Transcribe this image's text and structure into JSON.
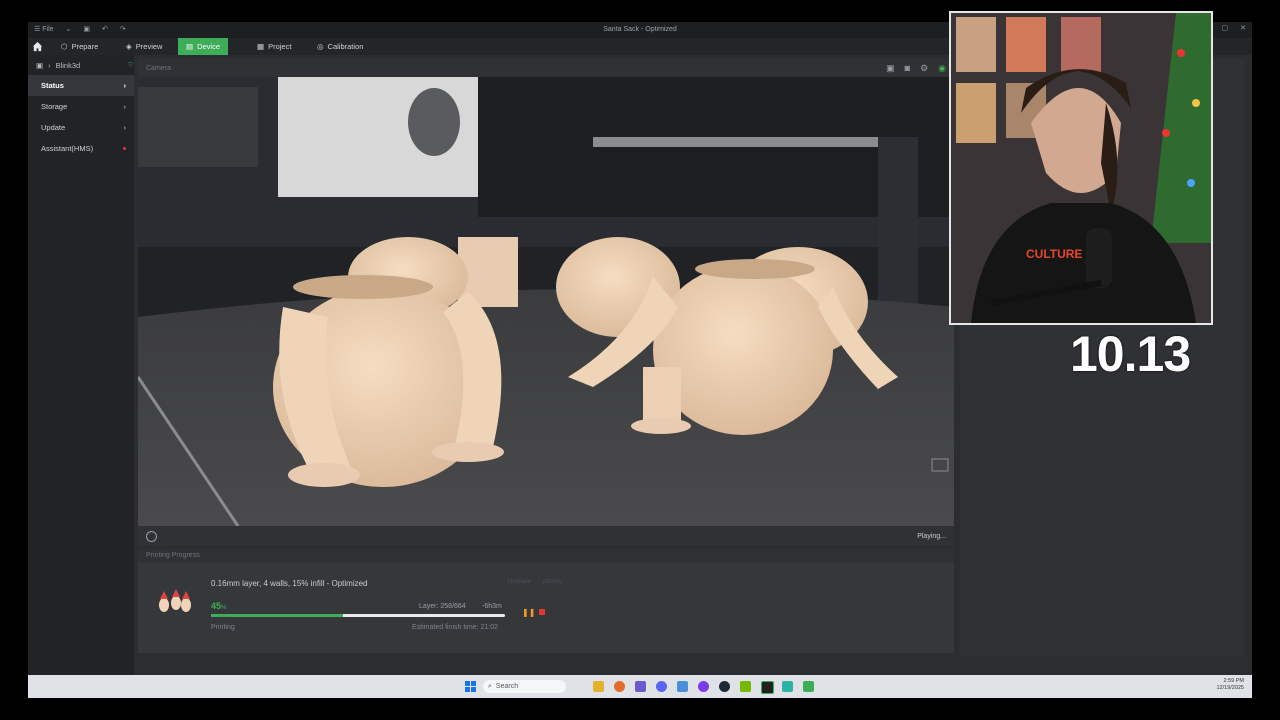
{
  "window": {
    "title": "Santa Sack - Optimized",
    "menu_label": "File"
  },
  "tabs": [
    {
      "label": "Prepare"
    },
    {
      "label": "Preview"
    },
    {
      "label": "Device"
    },
    {
      "label": "Project"
    },
    {
      "label": "Calibration"
    }
  ],
  "sidebar": {
    "printer_name": "Blink3d",
    "items": [
      {
        "label": "Status"
      },
      {
        "label": "Storage"
      },
      {
        "label": "Update"
      },
      {
        "label": "Assistant(HMS)"
      }
    ]
  },
  "camera": {
    "header_label": "Camera",
    "status_text": "Playing..."
  },
  "printing_progress": {
    "header": "Printing Progress",
    "job_name": "0.16mm layer, 4 walls, 15% infill - Optimized",
    "percent": "45",
    "percent_unit": "%",
    "progress_value": 0.45,
    "layer_text": "Layer: 258/664",
    "remaining_text": "-6h3m",
    "status_text": "Printing",
    "finish_text": "Estimated finish time: 21:02",
    "faded_labels": [
      "Unbrake",
      "pdusky"
    ]
  },
  "overlay": {
    "timer": "10.13"
  },
  "taskbar": {
    "search_placeholder": "Search",
    "clock_time": "2:59 PM",
    "clock_date": "12/19/2025"
  },
  "colors": {
    "accent": "#3dae57",
    "stop": "#e0392b",
    "pause": "#e89a2b"
  }
}
